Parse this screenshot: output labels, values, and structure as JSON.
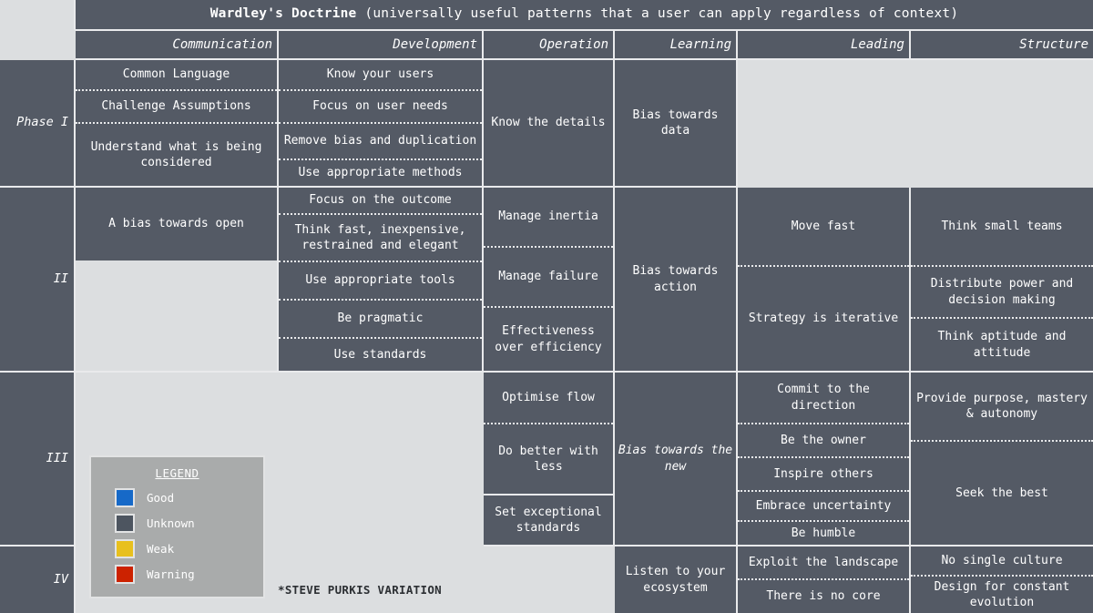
{
  "title": {
    "strong": "Wardley's Doctrine",
    "rest": " (universally useful patterns that a user can apply regardless of context)"
  },
  "columns": [
    {
      "key": "communication",
      "label": "Communication"
    },
    {
      "key": "development",
      "label": "Development"
    },
    {
      "key": "operation",
      "label": "Operation"
    },
    {
      "key": "learning",
      "label": "Learning"
    },
    {
      "key": "leading",
      "label": "Leading"
    },
    {
      "key": "structure",
      "label": "Structure"
    }
  ],
  "rows": [
    {
      "label": "Phase I",
      "communication": [
        "Common Language",
        "Challenge Assumptions",
        "Understand what is being considered"
      ],
      "development": [
        "Know your users",
        "Focus on user needs",
        "Remove bias and duplication",
        "Use appropriate methods"
      ],
      "operation": [
        "Know the details"
      ],
      "learning": [
        "Bias towards data"
      ],
      "leading": [],
      "structure": []
    },
    {
      "label": "II",
      "communication": [
        "A bias towards open"
      ],
      "development": [
        "Focus on the outcome",
        "Think fast, inexpensive, restrained and elegant",
        "Use appropriate tools",
        "Be pragmatic",
        "Use standards"
      ],
      "operation": [
        "Manage inertia",
        "Manage failure",
        "Effectiveness over efficiency"
      ],
      "learning": [
        "Bias towards action"
      ],
      "leading": [
        "Move fast",
        "Strategy is iterative"
      ],
      "structure": [
        "Think small teams",
        "Distribute power and decision making",
        "Think aptitude and attitude"
      ]
    },
    {
      "label": "III",
      "communication": [],
      "development": [],
      "operation": [
        "Optimise flow",
        "Do better with less",
        "Set exceptional standards"
      ],
      "learning": [
        "Bias towards the new"
      ],
      "leading": [
        "Commit to the direction",
        "Be the owner",
        "Inspire others",
        "Embrace uncertainty",
        "Be humble"
      ],
      "structure": [
        "Provide purpose, mastery & autonomy",
        "Seek the best"
      ]
    },
    {
      "label": "IV",
      "communication": [],
      "development": [],
      "operation": [],
      "learning": [
        "Listen to your ecosystem"
      ],
      "leading": [
        "Exploit the landscape",
        "There is no core"
      ],
      "structure": [
        "No single culture",
        "Design for constant evolution"
      ]
    }
  ],
  "legend": {
    "title": "LEGEND",
    "items": [
      {
        "label": "Good",
        "color": "#1669c8"
      },
      {
        "label": "Unknown",
        "color": "#4d5560"
      },
      {
        "label": "Weak",
        "color": "#e8c01e"
      },
      {
        "label": "Warning",
        "color": "#cc2200"
      }
    ]
  },
  "footnote": "*STEVE PURKIS VARIATION"
}
